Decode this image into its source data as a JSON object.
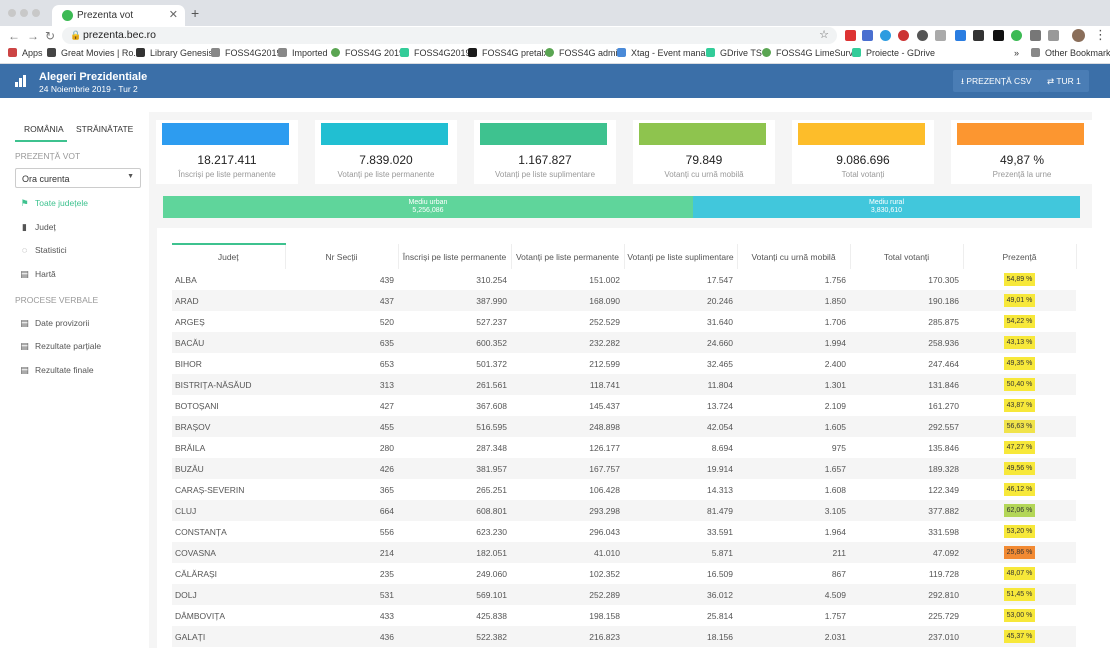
{
  "browser": {
    "tab_title": "Prezenta vot",
    "url": "prezenta.bec.ro",
    "bookmarks": [
      "Apps",
      "Great Movies | Ro...",
      "Library Genesis",
      "FOSS4G2019",
      "Imported",
      "FOSS4G 2019",
      "FOSS4G2019",
      "FOSS4G pretalx",
      "FOSS4G admin",
      "Xtag - Event mana...",
      "GDrive TS",
      "FOSS4G LimeSurv...",
      "Proiecte - GDrive",
      "»",
      "Other Bookmarks"
    ]
  },
  "header": {
    "title": "Alegeri Prezidentiale",
    "subtitle": "24 Noiembrie 2019 - Tur 2",
    "csv_button": "PREZENȚĂ CSV",
    "round_button": "TUR 1"
  },
  "sidebar": {
    "tabs": [
      "ROMÂNIA",
      "STRĂINĂTATE"
    ],
    "section_vote": "PREZENȚĂ VOT",
    "select_value": "Ora curenta",
    "items": [
      "Toate județele",
      "Județ",
      "Statistici",
      "Hartă"
    ],
    "section_pv": "PROCESE VERBALE",
    "pv_items": [
      "Date provizorii",
      "Rezultate parțiale",
      "Rezultate finale"
    ]
  },
  "cards": [
    {
      "value": "18.217.411",
      "label": "Înscriși pe liste permanente",
      "color": "#2d9cf0"
    },
    {
      "value": "7.839.020",
      "label": "Votanți pe liste permanente",
      "color": "#21bfd2"
    },
    {
      "value": "1.167.827",
      "label": "Votanți pe liste suplimentare",
      "color": "#3ec28f"
    },
    {
      "value": "79.849",
      "label": "Votanți cu urnă mobilă",
      "color": "#8ec44e"
    },
    {
      "value": "9.086.696",
      "label": "Total votanți",
      "color": "#fdbd2a"
    },
    {
      "value": "49,87 %",
      "label": "Prezență la urne",
      "color": "#fc9630"
    }
  ],
  "mediu": {
    "urban_label": "Mediu urban",
    "urban_value": "5,256,086",
    "urban_color": "#5fd59b",
    "rural_label": "Mediu rural",
    "rural_value": "3,830,610",
    "rural_color": "#41c7dc"
  },
  "table": {
    "columns": [
      "Județ",
      "Nr Secții",
      "Înscriși pe liste permanente",
      "Votanți pe liste permanente",
      "Votanți pe liste suplimentare",
      "Votanți cu urnă mobilă",
      "Total votanți",
      "Prezență"
    ],
    "rows": [
      [
        "ALBA",
        "439",
        "310.254",
        "151.002",
        "17.547",
        "1.756",
        "170.305",
        "54,89 %"
      ],
      [
        "ARAD",
        "437",
        "387.990",
        "168.090",
        "20.246",
        "1.850",
        "190.186",
        "49,01 %"
      ],
      [
        "ARGEȘ",
        "520",
        "527.237",
        "252.529",
        "31.640",
        "1.706",
        "285.875",
        "54,22 %"
      ],
      [
        "BACĂU",
        "635",
        "600.352",
        "232.282",
        "24.660",
        "1.994",
        "258.936",
        "43,13 %"
      ],
      [
        "BIHOR",
        "653",
        "501.372",
        "212.599",
        "32.465",
        "2.400",
        "247.464",
        "49,35 %"
      ],
      [
        "BISTRIȚA-NĂSĂUD",
        "313",
        "261.561",
        "118.741",
        "11.804",
        "1.301",
        "131.846",
        "50,40 %"
      ],
      [
        "BOTOȘANI",
        "427",
        "367.608",
        "145.437",
        "13.724",
        "2.109",
        "161.270",
        "43,87 %"
      ],
      [
        "BRAȘOV",
        "455",
        "516.595",
        "248.898",
        "42.054",
        "1.605",
        "292.557",
        "56,63 %"
      ],
      [
        "BRĂILA",
        "280",
        "287.348",
        "126.177",
        "8.694",
        "975",
        "135.846",
        "47,27 %"
      ],
      [
        "BUZĂU",
        "426",
        "381.957",
        "167.757",
        "19.914",
        "1.657",
        "189.328",
        "49,56 %"
      ],
      [
        "CARAȘ-SEVERIN",
        "365",
        "265.251",
        "106.428",
        "14.313",
        "1.608",
        "122.349",
        "46,12 %"
      ],
      [
        "CLUJ",
        "664",
        "608.801",
        "293.298",
        "81.479",
        "3.105",
        "377.882",
        "62,06 %"
      ],
      [
        "CONSTANȚA",
        "556",
        "623.230",
        "296.043",
        "33.591",
        "1.964",
        "331.598",
        "53,20 %"
      ],
      [
        "COVASNA",
        "214",
        "182.051",
        "41.010",
        "5.871",
        "211",
        "47.092",
        "25,86 %"
      ],
      [
        "CĂLĂRAȘI",
        "235",
        "249.060",
        "102.352",
        "16.509",
        "867",
        "119.728",
        "48,07 %"
      ],
      [
        "DOLJ",
        "531",
        "569.101",
        "252.289",
        "36.012",
        "4.509",
        "292.810",
        "51,45 %"
      ],
      [
        "DÂMBOVIȚA",
        "433",
        "425.838",
        "198.158",
        "25.814",
        "1.757",
        "225.729",
        "53,00 %"
      ],
      [
        "GALAȚI",
        "436",
        "522.382",
        "216.823",
        "18.156",
        "2.031",
        "237.010",
        "45,37 %"
      ]
    ],
    "badge_colors": [
      "#f7e83a",
      "#f7e83a",
      "#f7e83a",
      "#f7e83a",
      "#f7e83a",
      "#f7e83a",
      "#f7e83a",
      "#f0e34a",
      "#f7e83a",
      "#f7e83a",
      "#f7e83a",
      "#b3d657",
      "#f7e83a",
      "#f28a33",
      "#f7e83a",
      "#f7e83a",
      "#f7e83a",
      "#f7e83a"
    ]
  }
}
